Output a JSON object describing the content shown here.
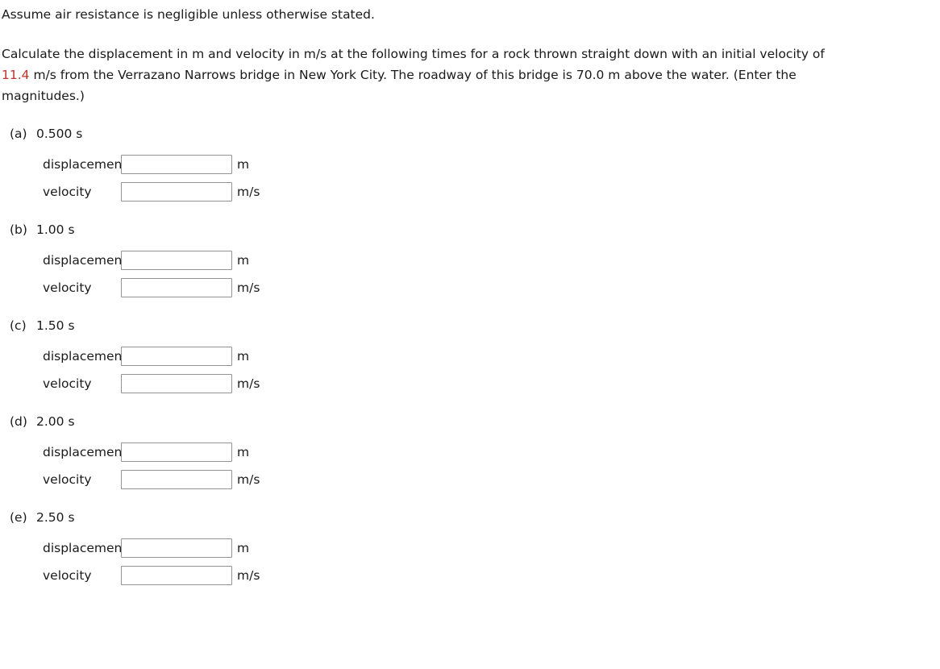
{
  "intro": {
    "note": "Assume air resistance is negligible unless otherwise stated."
  },
  "prompt": {
    "line1_a": "Calculate the displacement in m and velocity in m/s at the following times for a rock thrown straight down with an initial velocity of",
    "line2_highlight": "11.4",
    "line2_b": " m/s from the Verrazano Narrows bridge in New York City. The roadway of this bridge is 70.0 m above the water. (Enter the",
    "line3": "magnitudes.)",
    "highlight_color": "#c0332b"
  },
  "units": {
    "displacement": "m",
    "velocity": "m/s"
  },
  "labels": {
    "displacement": "displacement",
    "velocity": "velocity"
  },
  "parts": [
    {
      "letter": "(a)",
      "time": "0.500 s",
      "displacement_value": "",
      "velocity_value": ""
    },
    {
      "letter": "(b)",
      "time": "1.00 s",
      "displacement_value": "",
      "velocity_value": ""
    },
    {
      "letter": "(c)",
      "time": "1.50 s",
      "displacement_value": "",
      "velocity_value": ""
    },
    {
      "letter": "(d)",
      "time": "2.00 s",
      "displacement_value": "",
      "velocity_value": ""
    },
    {
      "letter": "(e)",
      "time": "2.50 s",
      "displacement_value": "",
      "velocity_value": ""
    }
  ]
}
